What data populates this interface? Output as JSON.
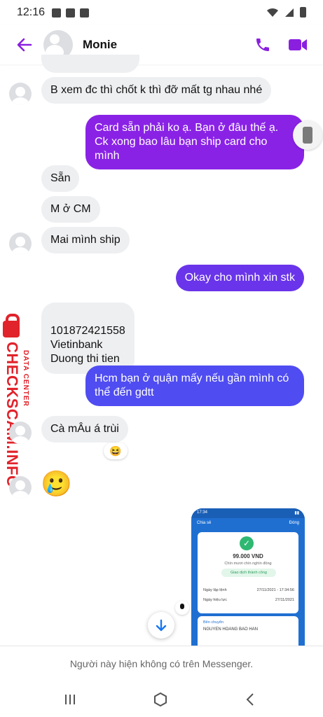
{
  "status_bar": {
    "time": "12:16"
  },
  "header": {
    "contact_name": "Monie"
  },
  "messages": [
    {
      "side": "in",
      "text": "B xem đc thì chốt k thì đỡ mất tg nhau nhé"
    },
    {
      "side": "out",
      "text": "Card sẵn phải ko ạ. Bạn ở đâu thế ạ. Ck xong bao lâu bạn ship card cho mình"
    },
    {
      "side": "in",
      "text": "Sẵn"
    },
    {
      "side": "in",
      "text": "M ở CM"
    },
    {
      "side": "in",
      "text": "Mai mình ship"
    },
    {
      "side": "out",
      "text": "Okay cho mình xin stk"
    },
    {
      "side": "in",
      "text": "101872421558\nVietinbank\nDuong thi tien"
    },
    {
      "side": "out",
      "text": "Hcm bạn ở quận mấy nếu gần mình có thể đến gdtt"
    },
    {
      "side": "in",
      "text": "Cà mÂu á trùi",
      "reaction": "😆"
    },
    {
      "side": "in",
      "text": "🥲",
      "emoji_only": true
    }
  ],
  "receipt": {
    "status_time": "17:34",
    "share_label": "Chia sẻ",
    "close_label": "Đóng",
    "amount": "99.000 VND",
    "amount_words": "Chín mươi chín nghìn đồng",
    "status": "Giao dịch thành công",
    "rows": [
      {
        "label": "Ngày lập lệnh",
        "value": "27/11/2021 - 17:34:56"
      },
      {
        "label": "Ngày hiệu lực",
        "value": "27/11/2021"
      }
    ],
    "beneficiary_label": "Bên chuyển",
    "beneficiary_name": "NGUYEN HOANG BAO HAN"
  },
  "watermark": {
    "main": "CHECKSCAM.INFO",
    "sub": "DATA CENTER"
  },
  "footer": {
    "notice": "Người này hiện không có trên Messenger."
  },
  "colors": {
    "accent": "#8a1fe0",
    "bubble_out_purple": "#8a22e6",
    "bubble_out_blue": "#4f4cf2",
    "bubble_in": "#eeeff1",
    "watermark": "#e1232b"
  }
}
